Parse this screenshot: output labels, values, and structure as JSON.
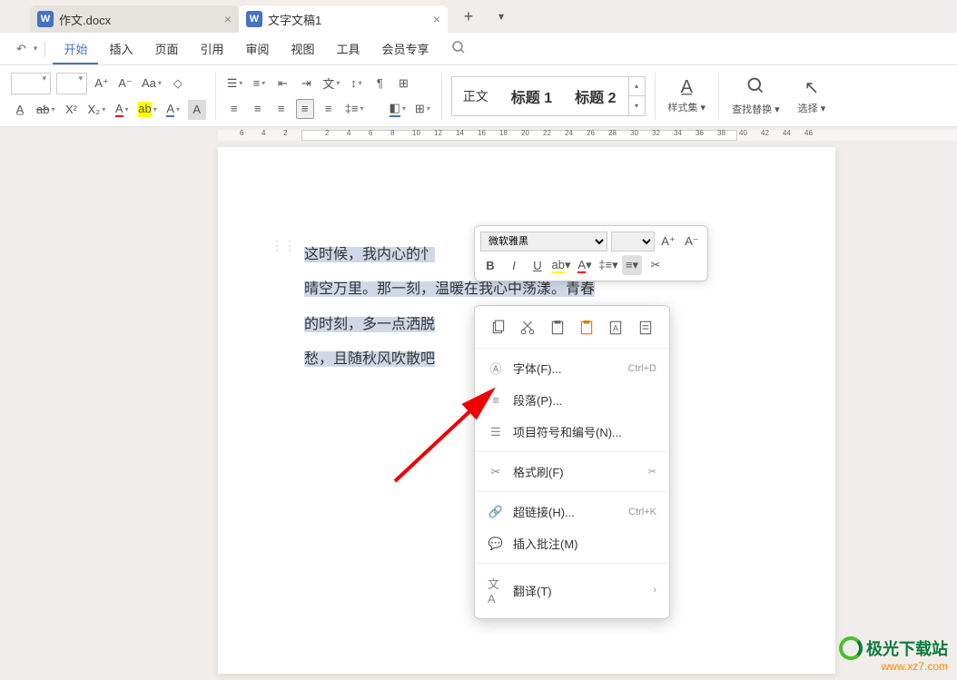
{
  "tabs": [
    {
      "icon": "W",
      "label": "作文.docx",
      "active": false
    },
    {
      "icon": "W",
      "label": "文字文稿1",
      "active": true
    }
  ],
  "menu": {
    "items": [
      "开始",
      "插入",
      "页面",
      "引用",
      "审阅",
      "视图",
      "工具",
      "会员专享"
    ],
    "active_index": 0
  },
  "styles": {
    "normal": "正文",
    "heading1": "标题 1",
    "heading2": "标题 2",
    "panel": "样式集",
    "find": "查找替换",
    "select": "选择"
  },
  "ruler": {
    "marks": [
      "6",
      "4",
      "2",
      "",
      "2",
      "4",
      "6",
      "8",
      "10",
      "12",
      "14",
      "16",
      "18",
      "20",
      "22",
      "24",
      "26",
      "28",
      "30",
      "32",
      "34",
      "36",
      "38",
      "40",
      "42",
      "44",
      "46"
    ]
  },
  "document": {
    "line1": "这时候，我内心的忄",
    "line2": "晴空万里。那一刻，温暖在我心中荡漾。青春",
    "line3": "的时刻，多一点洒脱",
    "line4": "愁，且随秋风吹散吧"
  },
  "mini_toolbar": {
    "font": "微软雅黑"
  },
  "context_menu": {
    "font": {
      "label": "字体(F)...",
      "shortcut": "Ctrl+D"
    },
    "paragraph": {
      "label": "段落(P)..."
    },
    "bullets": {
      "label": "项目符号和编号(N)..."
    },
    "format_painter": {
      "label": "格式刷(F)"
    },
    "hyperlink": {
      "label": "超链接(H)...",
      "shortcut": "Ctrl+K"
    },
    "comment": {
      "label": "插入批注(M)"
    },
    "translate": {
      "label": "翻译(T)"
    }
  },
  "watermark": {
    "name": "极光下载站",
    "url": "www.xz7.com"
  }
}
